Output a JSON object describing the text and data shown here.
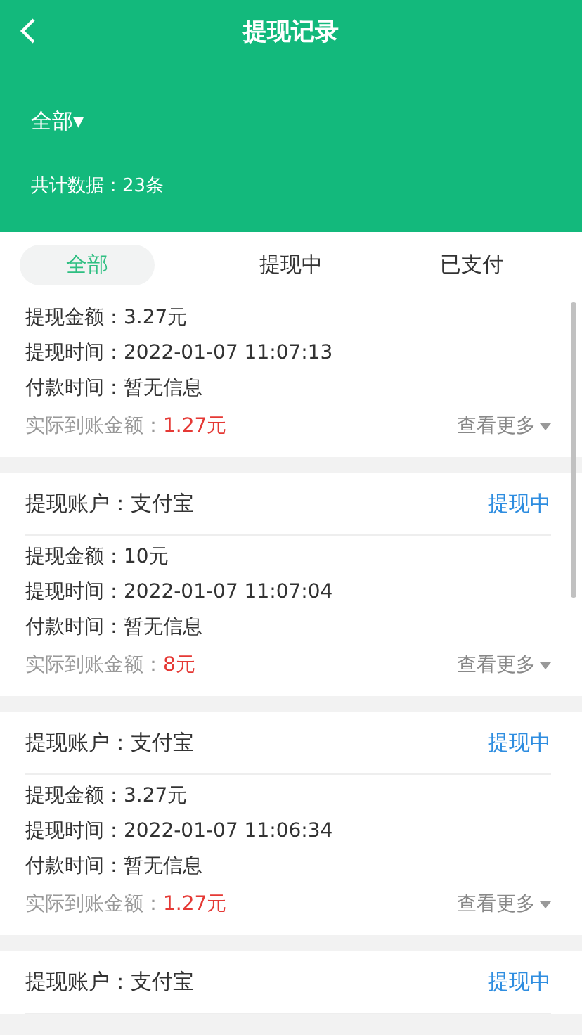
{
  "header": {
    "title": "提现记录",
    "filter": "全部▾",
    "total": "共计数据：23条"
  },
  "tabs": [
    {
      "label": "全部",
      "selected": true
    },
    {
      "label": "提现中",
      "selected": false
    },
    {
      "label": "已支付",
      "selected": false
    }
  ],
  "records": [
    {
      "lines": [
        {
          "label": "提现金额：",
          "value": "3.27元"
        },
        {
          "label": "提现时间：",
          "value": "2022-01-07 11:07:13"
        },
        {
          "label": "付款时间：",
          "value": "暂无信息"
        }
      ],
      "actual_label": "实际到账金额：",
      "actual_value": "1.27元",
      "more": "查看更多"
    },
    {
      "account": "提现账户：支付宝",
      "status": "提现中",
      "lines": [
        {
          "label": "提现金额：",
          "value": "10元"
        },
        {
          "label": "提现时间：",
          "value": "2022-01-07 11:07:04"
        },
        {
          "label": "付款时间：",
          "value": "暂无信息"
        }
      ],
      "actual_label": "实际到账金额：",
      "actual_value": "8元",
      "more": "查看更多"
    },
    {
      "account": "提现账户：支付宝",
      "status": "提现中",
      "lines": [
        {
          "label": "提现金额：",
          "value": "3.27元"
        },
        {
          "label": "提现时间：",
          "value": "2022-01-07 11:06:34"
        },
        {
          "label": "付款时间：",
          "value": "暂无信息"
        }
      ],
      "actual_label": "实际到账金额：",
      "actual_value": "1.27元",
      "more": "查看更多"
    },
    {
      "account": "提现账户：支付宝",
      "status": "提现中"
    }
  ]
}
